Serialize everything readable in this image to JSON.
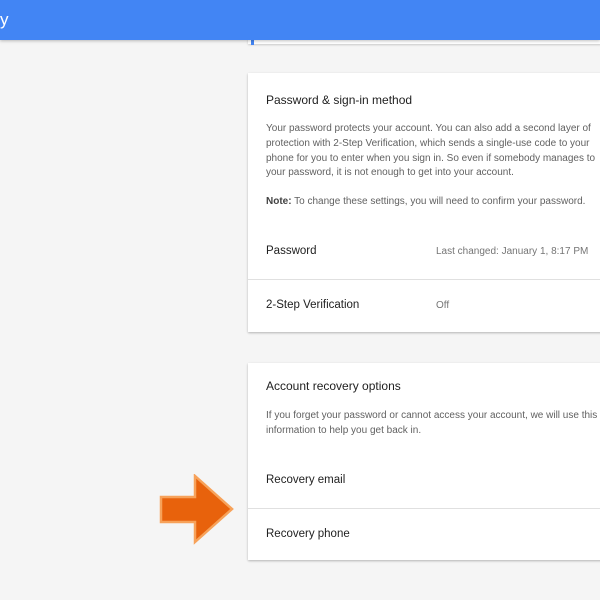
{
  "header": {
    "title": "y",
    "background_color": "#4285f4"
  },
  "password_section": {
    "title": "Password & sign-in method",
    "description": "Your password protects your account. You can also add a second layer of\nprotection with 2-Step Verification, which sends a single-use code to your\nphone for you to enter when you sign in. So even if somebody manages to\nyour password, it is not enough to get into your account.",
    "note_label": "Note:",
    "note_text": " To change these settings, you will need to confirm your password.",
    "rows": [
      {
        "label": "Password",
        "value": "Last changed: January 1, 8:17 PM"
      },
      {
        "label": "2-Step Verification",
        "value": "Off"
      }
    ]
  },
  "recovery_section": {
    "title": "Account recovery options",
    "description": "If you forget your password or cannot access your account, we will use this\ninformation to help you get back in.",
    "rows": [
      {
        "label": "Recovery email",
        "value": ""
      },
      {
        "label": "Recovery phone",
        "value": ""
      }
    ]
  },
  "annotation": {
    "icon": "arrow-right-icon",
    "fill_color": "#e8620c",
    "stroke_color": "#f7a25a"
  }
}
